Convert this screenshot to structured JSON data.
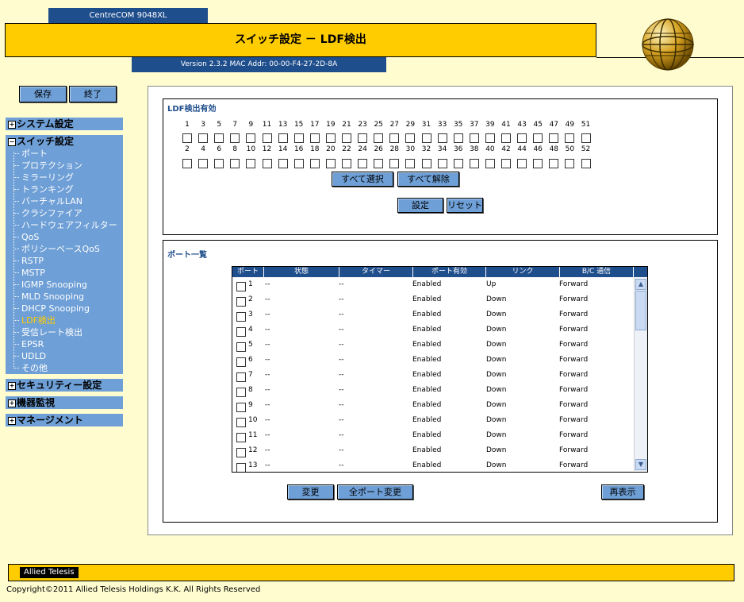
{
  "header": {
    "model": "CentreCOM 9048XL",
    "title": "スイッチ設定 － LDF検出",
    "version": "Version 2.3.2 MAC Addr: 00-00-F4-27-2D-8A"
  },
  "sidebar": {
    "save_label": "保存",
    "exit_label": "終了",
    "system": "システム設定",
    "switch": "スイッチ設定",
    "security": "セキュリティー設定",
    "monitor": "機器監視",
    "management": "マネージメント",
    "items": [
      "ポート",
      "プロテクション",
      "ミラーリング",
      "トランキング",
      "バーチャルLAN",
      "クラシファイア",
      "ハードウェアフィルター",
      "QoS",
      "ポリシーベースQoS",
      "RSTP",
      "MSTP",
      "IGMP Snooping",
      "MLD Snooping",
      "DHCP Snooping",
      "LDF検出",
      "受信レート検出",
      "EPSR",
      "UDLD",
      "その他"
    ],
    "active_index": 14
  },
  "ldf": {
    "title": "LDF検出有効",
    "odd_ports": [
      "1",
      "3",
      "5",
      "7",
      "9",
      "11",
      "13",
      "15",
      "17",
      "19",
      "21",
      "23",
      "25",
      "27",
      "29",
      "31",
      "33",
      "35",
      "37",
      "39",
      "41",
      "43",
      "45",
      "47",
      "49",
      "51"
    ],
    "even_ports": [
      "2",
      "4",
      "6",
      "8",
      "10",
      "12",
      "14",
      "16",
      "18",
      "20",
      "22",
      "24",
      "26",
      "28",
      "30",
      "32",
      "34",
      "36",
      "38",
      "40",
      "42",
      "44",
      "46",
      "48",
      "50",
      "52"
    ],
    "select_all": "すべて選択",
    "clear_all": "すべて解除",
    "apply": "設定",
    "reset": "リセット"
  },
  "ports": {
    "title": "ポート一覧",
    "columns": [
      "ポート",
      "状態",
      "タイマー",
      "ポート有効",
      "リンク",
      "B/C 通信"
    ],
    "rows": [
      {
        "port": "1",
        "status": "--",
        "timer": "--",
        "enabled": "Enabled",
        "link": "Up",
        "bc": "Forward"
      },
      {
        "port": "2",
        "status": "--",
        "timer": "--",
        "enabled": "Enabled",
        "link": "Down",
        "bc": "Forward"
      },
      {
        "port": "3",
        "status": "--",
        "timer": "--",
        "enabled": "Enabled",
        "link": "Down",
        "bc": "Forward"
      },
      {
        "port": "4",
        "status": "--",
        "timer": "--",
        "enabled": "Enabled",
        "link": "Down",
        "bc": "Forward"
      },
      {
        "port": "5",
        "status": "--",
        "timer": "--",
        "enabled": "Enabled",
        "link": "Down",
        "bc": "Forward"
      },
      {
        "port": "6",
        "status": "--",
        "timer": "--",
        "enabled": "Enabled",
        "link": "Down",
        "bc": "Forward"
      },
      {
        "port": "7",
        "status": "--",
        "timer": "--",
        "enabled": "Enabled",
        "link": "Down",
        "bc": "Forward"
      },
      {
        "port": "8",
        "status": "--",
        "timer": "--",
        "enabled": "Enabled",
        "link": "Down",
        "bc": "Forward"
      },
      {
        "port": "9",
        "status": "--",
        "timer": "--",
        "enabled": "Enabled",
        "link": "Down",
        "bc": "Forward"
      },
      {
        "port": "10",
        "status": "--",
        "timer": "--",
        "enabled": "Enabled",
        "link": "Down",
        "bc": "Forward"
      },
      {
        "port": "11",
        "status": "--",
        "timer": "--",
        "enabled": "Enabled",
        "link": "Down",
        "bc": "Forward"
      },
      {
        "port": "12",
        "status": "--",
        "timer": "--",
        "enabled": "Enabled",
        "link": "Down",
        "bc": "Forward"
      },
      {
        "port": "13",
        "status": "--",
        "timer": "--",
        "enabled": "Enabled",
        "link": "Down",
        "bc": "Forward"
      }
    ],
    "change": "変更",
    "change_all": "全ポート変更",
    "refresh": "再表示"
  },
  "footer": {
    "logo": "Allied Telesis",
    "copyright": "Copyright©2011 Allied Telesis Holdings K.K. All Rights Reserved"
  },
  "colors": {
    "accent": "#FFCC00",
    "nav": "#6E9FD6",
    "dark": "#1F4E8C",
    "bg": "#FFFDD0"
  }
}
